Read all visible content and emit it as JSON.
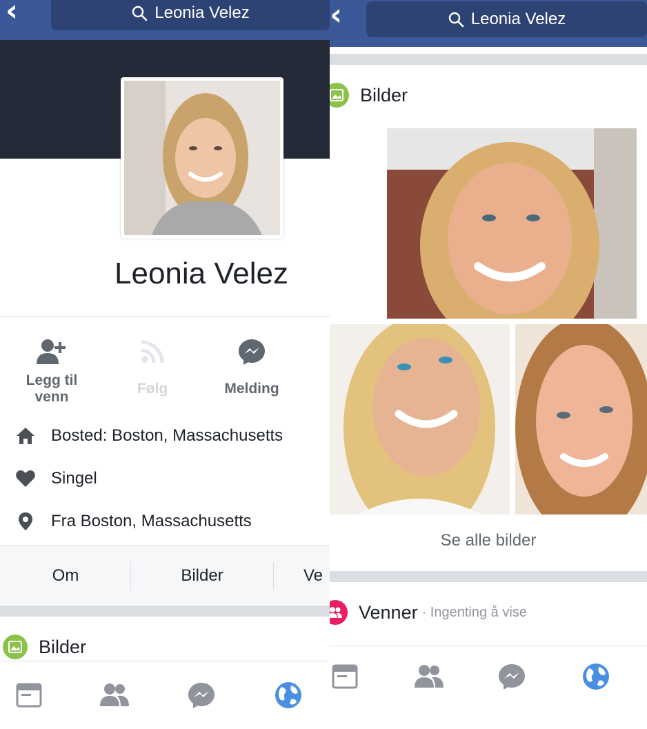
{
  "left": {
    "search": {
      "text": "Leonia Velez"
    },
    "profile": {
      "name": "Leonia Velez"
    },
    "actions": [
      {
        "label": "Legg til venn",
        "icon": "add-friend-icon",
        "enabled": true
      },
      {
        "label": "Følg",
        "icon": "follow-icon",
        "enabled": false
      },
      {
        "label": "Melding",
        "icon": "messenger-icon",
        "enabled": true
      }
    ],
    "info": [
      {
        "icon": "home-icon",
        "text": "Bosted: Boston, Massachusetts"
      },
      {
        "icon": "heart-icon",
        "text": "Singel"
      },
      {
        "icon": "location-pin-icon",
        "text": "Fra Boston, Massachusetts"
      }
    ],
    "tabs": [
      "Om",
      "Bilder",
      "Ve"
    ],
    "section": {
      "title": "Bilder"
    }
  },
  "right": {
    "search": {
      "text": "Leonia Velez"
    },
    "photos_section": {
      "title": "Bilder",
      "see_all": "Se alle bilder"
    },
    "friends_section": {
      "title": "Venner",
      "subtitle": "· Ingenting å vise"
    }
  },
  "bottom_nav": [
    "news-feed-icon",
    "friends-icon",
    "messenger-icon",
    "globe-icon"
  ],
  "colors": {
    "nav_blue": "#3b5998",
    "search_blue": "#2d4373",
    "cover": "#242a38",
    "photos_green": "#8bc34a",
    "friends_pink": "#e91e63",
    "globe_blue": "#4a90e2"
  }
}
